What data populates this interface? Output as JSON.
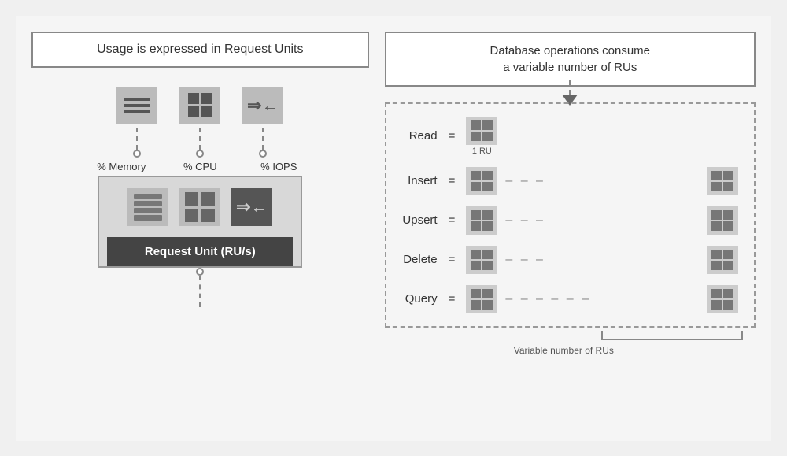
{
  "left": {
    "title": "Usage is expressed in Request Units",
    "metrics": [
      {
        "label": "% Memory"
      },
      {
        "label": "% CPU"
      },
      {
        "label": "% IOPS"
      }
    ],
    "ru_label": "Request Unit (RU/s)"
  },
  "right": {
    "title_line1": "Database operations consume",
    "title_line2": "a variable number of RUs",
    "ops": [
      {
        "label": "Read",
        "dashes": "",
        "has_right": false,
        "ru_label": "1 RU"
      },
      {
        "label": "Insert",
        "dashes": "– – –",
        "has_right": true
      },
      {
        "label": "Upsert",
        "dashes": "– – –",
        "has_right": true
      },
      {
        "label": "Delete",
        "dashes": "– – –",
        "has_right": true
      },
      {
        "label": "Query",
        "dashes": "– – – – – –",
        "has_right": true
      }
    ],
    "variable_label": "Variable number of RUs"
  }
}
